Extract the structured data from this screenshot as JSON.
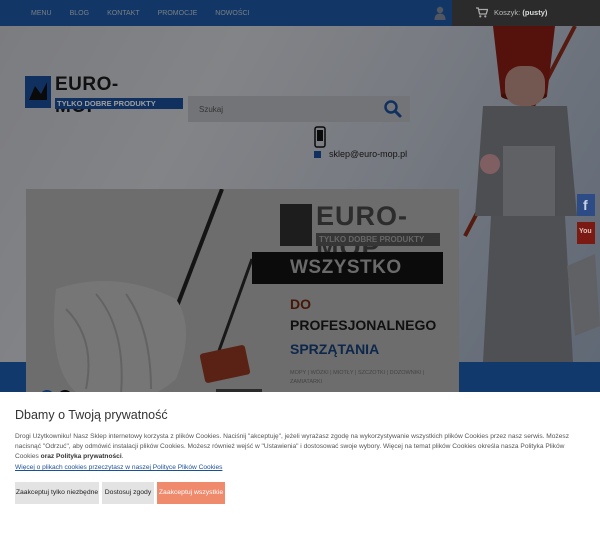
{
  "nav": {
    "items": [
      "MENU",
      "BLOG",
      "KONTAKT",
      "PROMOCJE",
      "NOWOŚCI"
    ]
  },
  "cart": {
    "label": "Koszyk:",
    "status": "(pusty)"
  },
  "icons": {
    "user": "user-icon",
    "cart": "cart-icon",
    "search": "search-icon",
    "phone": "phone-icon",
    "email": "email-icon",
    "facebook": "facebook-icon",
    "youtube": "youtube-icon"
  },
  "logo": {
    "title": "EURO-MOP",
    "subtitle": "TYLKO DOBRE PRODUKTY"
  },
  "search": {
    "placeholder": "Szukaj"
  },
  "contact": {
    "email": "sklep@euro-mop.pl"
  },
  "slider": {
    "logo_title": "EURO-MOP",
    "logo_subtitle": "TYLKO DOBRE PRODUKTY",
    "banner": "WSZYSTKO",
    "line1": "DO",
    "line2": "PROFESJONALNEGO",
    "line3": "SPRZĄTANIA",
    "tags": "MOPY | WÓZKI | MIOTŁY | SZCZOTKI | DOZOWNIKI | ZAMIATARKI"
  },
  "social": {
    "facebook_glyph": "f",
    "youtube_glyph": "You"
  },
  "cookie": {
    "title": "Dbamy o Twoją prywatność",
    "body_1": "Drogi Użytkowniku! Nasz Sklep internetowy korzysta z plików Cookies. Naciśnij \"akceptuję\", jeżeli wyrażasz zgodę na wykorzystywanie wszystkich plików Cookies przez nasz serwis. Możesz nacisnąć \"Odrzuć\", aby odmówić instalacji plików Cookies. Możesz również wejść w \"Ustawienia\" i dostosować swoje wybory. Więcej na temat plików Cookies określa nasza Polityka Plików Cookies",
    "body_bold": "oraz Polityka prywatności",
    "body_end": ".",
    "link": "Więcej o plikach cookies przeczytasz w naszej Polityce Plików Cookies",
    "btn_necessary": "Zaakceptuj tylko niezbędne",
    "btn_settings": "Dostosuj zgody",
    "btn_accept": "Zaakceptuj wszystkie"
  },
  "colors": {
    "brand_blue": "#1b4f99",
    "accept_button": "#ef8a6c",
    "cart_bg": "#2b2b2b"
  }
}
